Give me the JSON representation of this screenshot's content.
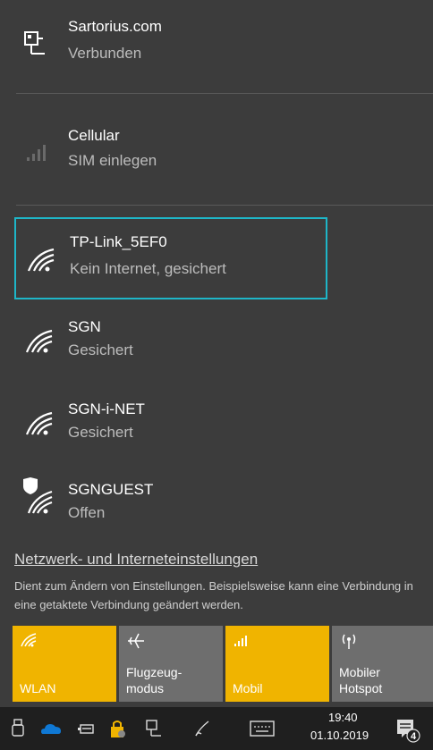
{
  "networks": [
    {
      "name": "Sartorius.com",
      "status": "Verbunden",
      "icon": "ethernet-icon"
    },
    {
      "name": "Cellular",
      "status": "SIM einlegen",
      "icon": "cellular-signal-icon"
    },
    {
      "name": "TP-Link_5EF0",
      "status": "Kein Internet, gesichert",
      "icon": "wifi-icon",
      "selected": true
    },
    {
      "name": "SGN",
      "status": "Gesichert",
      "icon": "wifi-icon"
    },
    {
      "name": "SGN-i-NET",
      "status": "Gesichert",
      "icon": "wifi-icon"
    },
    {
      "name": "SGNGUEST",
      "status": "Offen",
      "icon": "wifi-shield-icon"
    }
  ],
  "settings": {
    "link": "Netzwerk- und Interneteinstellungen",
    "description": "Dient zum Ändern von Einstellungen. Beispielsweise kann eine Verbindung in eine getaktete Verbindung geändert werden."
  },
  "tiles": [
    {
      "label": "WLAN",
      "icon": "wifi-icon",
      "on": true
    },
    {
      "label_line1": "Flugzeug-",
      "label_line2": "modus",
      "icon": "airplane-icon",
      "on": false
    },
    {
      "label": "Mobil",
      "icon": "cellular-signal-icon",
      "on": true
    },
    {
      "label_line1": "Mobiler",
      "label_line2": "Hotspot",
      "icon": "hotspot-icon",
      "on": false
    }
  ],
  "taskbar": {
    "time": "19:40",
    "date": "01.10.2019",
    "notification_count": "4"
  },
  "colors": {
    "panel_bg": "#3c3c3c",
    "accent_tile": "#f0b400",
    "selected_border": "#1eb6c8",
    "taskbar_bg": "#1f1f1f"
  }
}
